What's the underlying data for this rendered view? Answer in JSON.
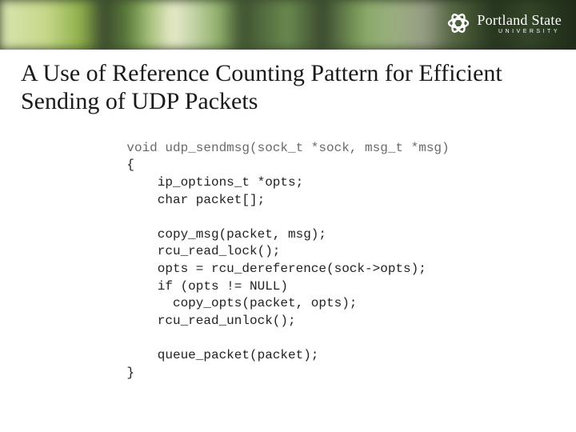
{
  "banner": {
    "brand_main": "Portland State",
    "brand_sub": "UNIVERSITY"
  },
  "title": "A Use of Reference Counting Pattern for Efficient Sending of UDP Packets",
  "code": {
    "signature": "void udp_sendmsg(sock_t *sock, msg_t *msg)",
    "body": "{\n    ip_options_t *opts;\n    char packet[];\n\n    copy_msg(packet, msg);\n    rcu_read_lock();\n    opts = rcu_dereference(sock->opts);\n    if (opts != NULL)\n      copy_opts(packet, opts);\n    rcu_read_unlock();\n\n    queue_packet(packet);\n}"
  }
}
